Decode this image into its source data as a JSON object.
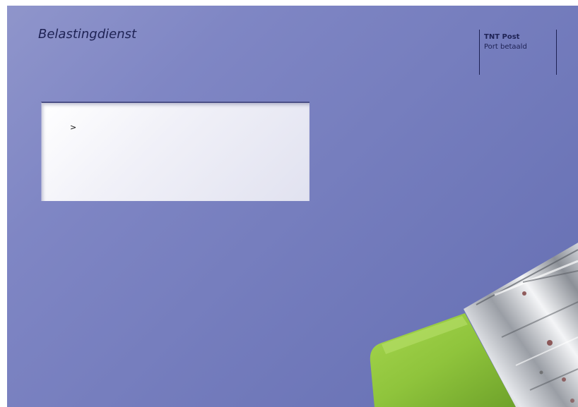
{
  "sender": {
    "name": "Belastingdienst"
  },
  "postage": {
    "carrier": "TNT Post",
    "status": "Port betaald"
  },
  "address_window": {
    "prompt": ">"
  },
  "colors": {
    "envelope": "#767ebe",
    "text": "#1e2254",
    "eraser": "#8fc43c",
    "ferrule": "#c8ccd2"
  },
  "decoration": {
    "illustration": "pencil-eraser"
  }
}
